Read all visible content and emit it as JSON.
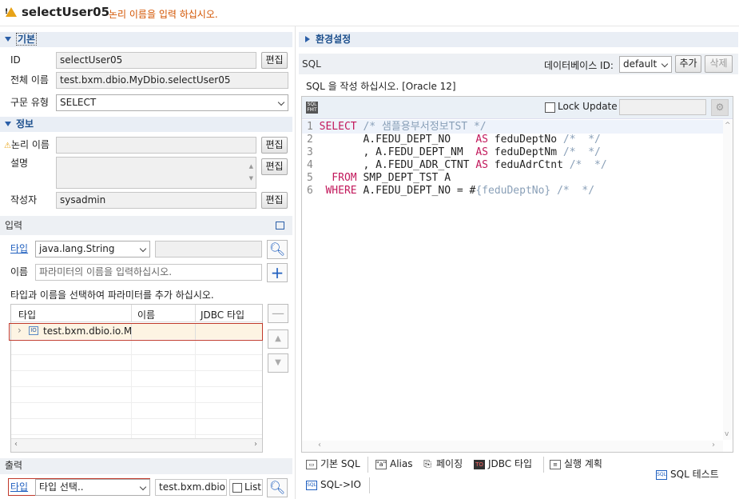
{
  "header": {
    "title": "selectUser05",
    "message": "논리 이름을 입력 하십시오."
  },
  "basic": {
    "section": "기본",
    "id_label": "ID",
    "id_value": "selectUser05",
    "edit": "편집",
    "fullname_label": "전체 이름",
    "fullname_value": "test.bxm.dbio.MyDbio.selectUser05",
    "type_label": "구문 유형",
    "type_value": "SELECT"
  },
  "info": {
    "section": "정보",
    "logical_label": "논리 이름",
    "desc_label": "설명",
    "author_label": "작성자",
    "author_value": "sysadmin",
    "edit": "편집"
  },
  "input": {
    "section": "입력",
    "type_link": "타입",
    "type_value": "java.lang.String",
    "name_label": "이름",
    "name_placeholder": "파라미터의 이름을 입력하십시오.",
    "hint": "타입과 이름을 선택하여 파라미터를 추가 하십시오.",
    "columns": [
      "타입",
      "이름",
      "JDBC 타입"
    ],
    "rows": [
      {
        "type": "test.bxm.dbio.io.MyI",
        "name": "",
        "jdbc": ""
      }
    ]
  },
  "output": {
    "section": "출력",
    "type_link": "타입",
    "type_value": "타입 선택..",
    "class_value": "test.bxm.dbio.ic",
    "list_label": "List"
  },
  "right": {
    "env_section": "환경설정",
    "sql_label": "SQL",
    "db_label": "데이터베이스 ID:",
    "db_value": "default",
    "add": "추가",
    "delete": "삭제",
    "hint": "SQL 을 작성 하십시오. [Oracle 12]",
    "lock": "Lock Update"
  },
  "sql": [
    {
      "n": "1",
      "parts": [
        {
          "t": "SELECT",
          "c": "kw"
        },
        {
          "t": " /* 샘플용부서정보TST */",
          "c": "cm"
        }
      ]
    },
    {
      "n": "2",
      "parts": [
        {
          "t": "       A.FEDU_DEPT_NO    ",
          "c": ""
        },
        {
          "t": "AS",
          "c": "kw"
        },
        {
          "t": " feduDeptNo ",
          "c": ""
        },
        {
          "t": "/*  */",
          "c": "cm"
        }
      ]
    },
    {
      "n": "3",
      "parts": [
        {
          "t": "       , A.FEDU_DEPT_NM  ",
          "c": ""
        },
        {
          "t": "AS",
          "c": "kw"
        },
        {
          "t": " feduDeptNm ",
          "c": ""
        },
        {
          "t": "/*  */",
          "c": "cm"
        }
      ]
    },
    {
      "n": "4",
      "parts": [
        {
          "t": "       , A.FEDU_ADR_CTNT ",
          "c": ""
        },
        {
          "t": "AS",
          "c": "kw"
        },
        {
          "t": " feduAdrCtnt ",
          "c": ""
        },
        {
          "t": "/*  */",
          "c": "cm"
        }
      ]
    },
    {
      "n": "5",
      "parts": [
        {
          "t": "  FROM",
          "c": "kw"
        },
        {
          "t": " SMP_DEPT_TST A",
          "c": ""
        }
      ]
    },
    {
      "n": "6",
      "parts": [
        {
          "t": " WHERE",
          "c": "kw"
        },
        {
          "t": " A.FEDU_DEPT_NO = #",
          "c": ""
        },
        {
          "t": "{feduDeptNo}",
          "c": "cm"
        },
        {
          "t": " ",
          "c": ""
        },
        {
          "t": "/*  */",
          "c": "cm"
        }
      ]
    }
  ],
  "toolbar": {
    "basic_sql": "기본 SQL",
    "alias": "Alias",
    "paging": "페이징",
    "jdbc": "JDBC 타입",
    "plan": "실행 계획",
    "test": "SQL 테스트",
    "sqlio": "SQL->IO"
  }
}
